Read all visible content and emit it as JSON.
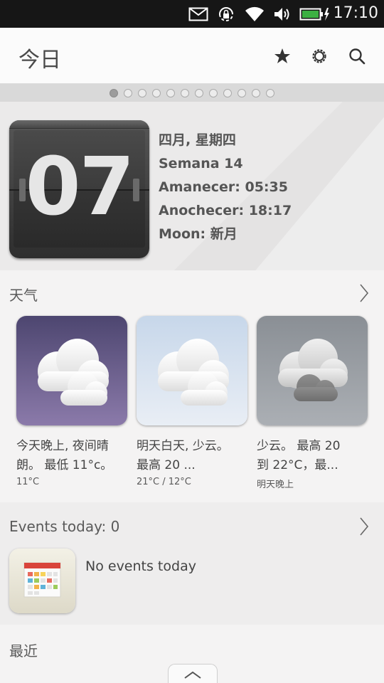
{
  "status_bar": {
    "time": "17:10",
    "icons": [
      "envelope-icon",
      "lock-rotation-icon",
      "wifi-icon",
      "volume-icon",
      "battery-charging-icon"
    ],
    "battery_color": "#3cb043"
  },
  "header": {
    "title": "今日",
    "actions": [
      "star-icon",
      "gear-icon",
      "search-icon"
    ]
  },
  "pager": {
    "total": 12,
    "active": 1
  },
  "date": {
    "day": "07",
    "line1": "四月, 星期四",
    "line2": "Semana 14",
    "line3": "Amanecer: 05:35",
    "line4": "Anochecer: 18:17",
    "line5": "Moon: 新月"
  },
  "weather": {
    "title": "天气",
    "cards": [
      {
        "line1": "今天晚上, 夜间晴",
        "line2": "朗。 最低 11°c。",
        "temp": "11°C",
        "bg_top": "#4f4775",
        "bg_bottom": "#8a78a8"
      },
      {
        "line1": "明天白天, 少云。",
        "line2": "最高 20 ...",
        "temp": "21°C / 12°C",
        "bg_top": "#c9d8ea",
        "bg_bottom": "#e8eef5"
      },
      {
        "line1": "少云。 最高 20",
        "line2": "到 22°C，最...",
        "temp": "明天晚上",
        "bg_top": "#8c9197",
        "bg_bottom": "#a9adb2"
      }
    ]
  },
  "events": {
    "title": "Events today: 0",
    "empty_text": "No events today"
  },
  "recent": {
    "title": "最近"
  }
}
